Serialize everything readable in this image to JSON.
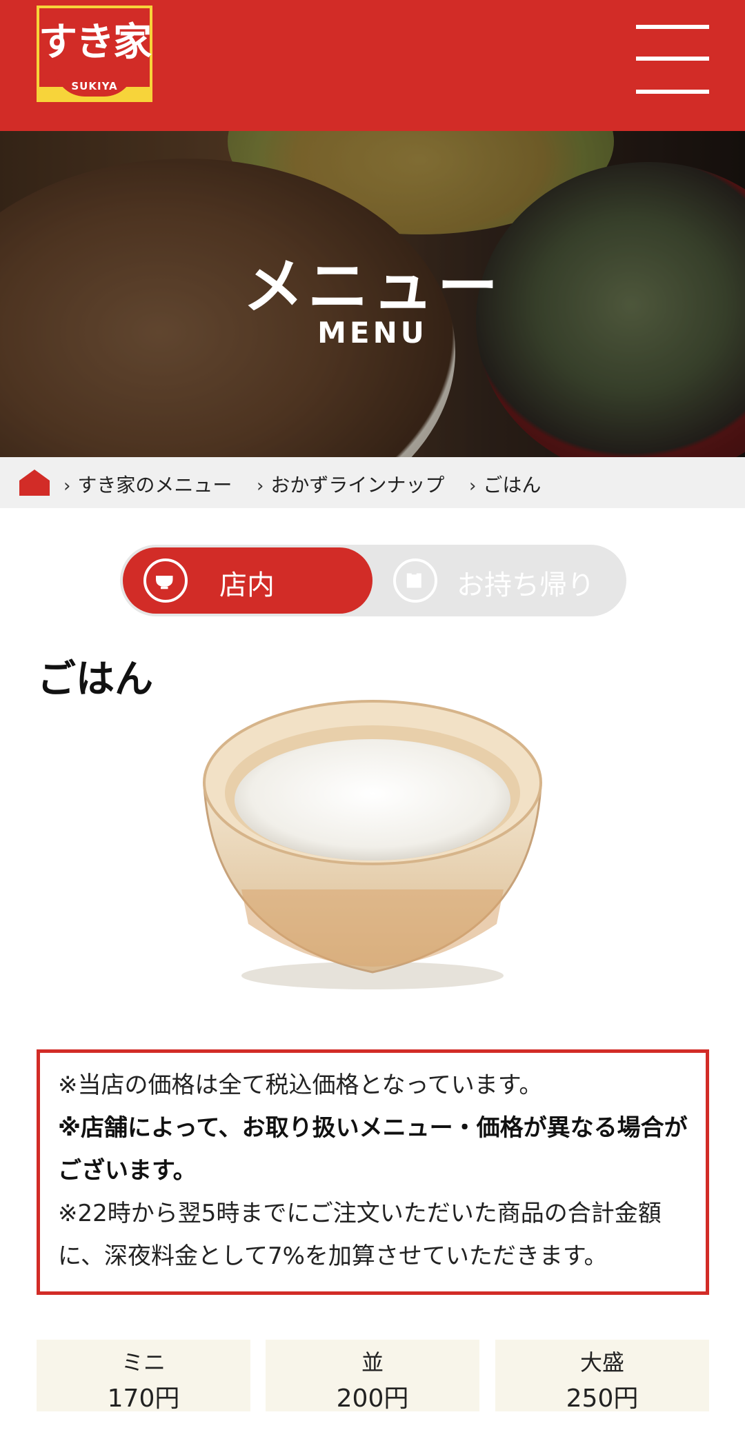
{
  "header": {
    "logo_text": "すき家",
    "logo_sub": "SUKIYA",
    "brand_color": "#d22c27",
    "logo_bg_color": "#f7d43a"
  },
  "hero": {
    "title": "メニュー",
    "subtitle": "MENU"
  },
  "breadcrumb": {
    "items": [
      {
        "label": "すき家のメニュー"
      },
      {
        "label": "おかずラインナップ"
      },
      {
        "label": "ごはん"
      }
    ]
  },
  "toggle": {
    "dine_in_label": "店内",
    "takeout_label": "お持ち帰り"
  },
  "product": {
    "name": "ごはん"
  },
  "notice": {
    "line1": "※当店の価格は全て税込価格となっています。",
    "line2": "※店舗によって、お取り扱いメニュー・価格が異なる場合がございます。",
    "line3": "※22時から翌5時までにご注文いただいた商品の合計金額に、深夜料金として7%を加算させていただきます。"
  },
  "prices": [
    {
      "size": "ミニ",
      "price": "170円"
    },
    {
      "size": "並",
      "price": "200円"
    },
    {
      "size": "大盛",
      "price": "250円"
    }
  ]
}
